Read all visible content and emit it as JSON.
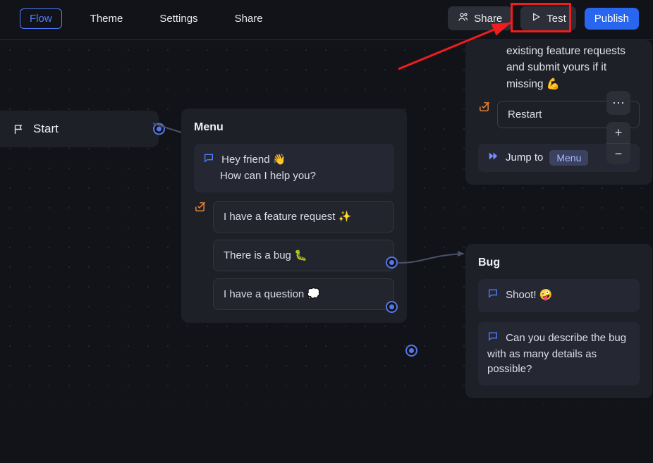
{
  "topbar": {
    "tabs": {
      "flow": "Flow",
      "theme": "Theme",
      "settings": "Settings",
      "share": "Share"
    },
    "share_btn": "Share",
    "test_btn": "Test",
    "publish_btn": "Publish"
  },
  "start": {
    "label": "Start"
  },
  "menu": {
    "title": "Menu",
    "greeting_line1": "Hey friend 👋",
    "greeting_line2": "How can I help you?",
    "options": {
      "feature": "I have a feature request ✨",
      "bug": "There is a bug 🐛",
      "question": "I have a question 💭"
    }
  },
  "feature": {
    "tail": "existing feature requests and submit yours if it missing 💪",
    "restart": "Restart",
    "jump_label": "Jump to",
    "jump_target": "Menu"
  },
  "bug": {
    "title": "Bug",
    "msg1": "Shoot! 🤪",
    "msg2": "Can you describe the bug with as many details as possible?"
  }
}
